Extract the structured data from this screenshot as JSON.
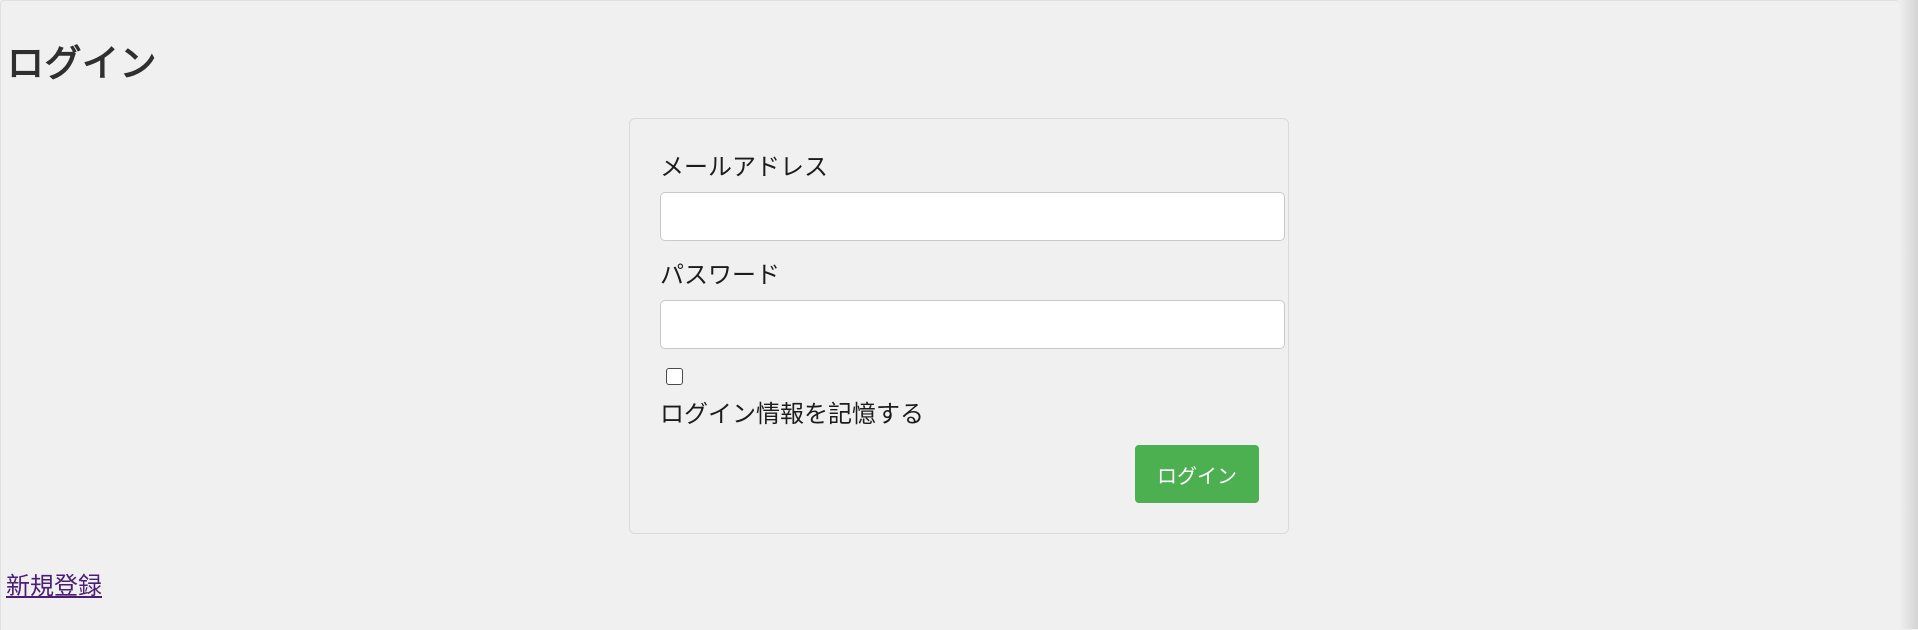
{
  "page": {
    "title": "ログイン"
  },
  "form": {
    "email_label": "メールアドレス",
    "email_value": "",
    "password_label": "パスワード",
    "password_value": "",
    "remember_label": "ログイン情報を記憶する",
    "remember_checked": false,
    "submit_label": "ログイン"
  },
  "links": {
    "register": "新規登録"
  },
  "colors": {
    "background": "#f0f0f0",
    "submit_button": "#4caf50",
    "link": "#4b1d74"
  }
}
